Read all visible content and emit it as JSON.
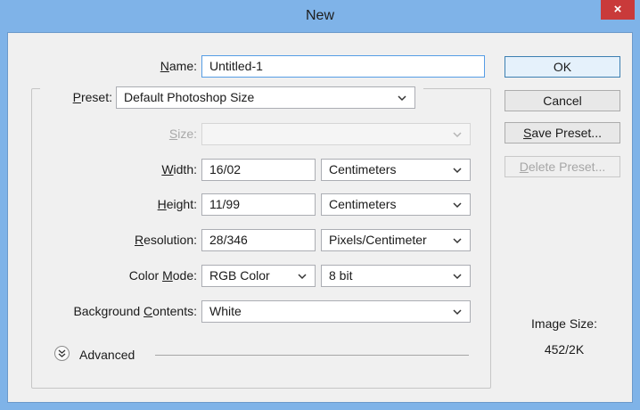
{
  "window": {
    "title": "New",
    "close_glyph": "×"
  },
  "name": {
    "label_pre": "",
    "label_key": "N",
    "label_post": "ame:",
    "value": "Untitled-1"
  },
  "preset": {
    "label_pre": "",
    "label_key": "P",
    "label_post": "reset:",
    "value": "Default Photoshop Size"
  },
  "size": {
    "label_pre": "",
    "label_key": "S",
    "label_post": "ize:",
    "value": ""
  },
  "width": {
    "label_pre": "",
    "label_key": "W",
    "label_post": "idth:",
    "value": "16/02",
    "unit": "Centimeters"
  },
  "height": {
    "label_pre": "",
    "label_key": "H",
    "label_post": "eight:",
    "value": "11/99",
    "unit": "Centimeters"
  },
  "resolution": {
    "label_pre": "",
    "label_key": "R",
    "label_post": "esolution:",
    "value": "28/346",
    "unit": "Pixels/Centimeter"
  },
  "color_mode": {
    "label_pre": "Color ",
    "label_key": "M",
    "label_post": "ode:",
    "value": "RGB Color",
    "bits": "8 bit"
  },
  "background": {
    "label_pre": "Background ",
    "label_key": "C",
    "label_post": "ontents:",
    "value": "White"
  },
  "advanced": {
    "label": "Advanced"
  },
  "buttons": {
    "ok": "OK",
    "cancel": "Cancel",
    "save_preset_key": "S",
    "save_preset_rest": "ave Preset...",
    "delete_preset_key": "D",
    "delete_preset_rest": "elete Preset..."
  },
  "image_size": {
    "label": "Image Size:",
    "value": "452/2K"
  },
  "icons": {
    "close": "close-icon",
    "dropdown": "chevron-down-icon",
    "advanced": "double-chevron-down-icon"
  },
  "colors": {
    "titlebar": "#7fb3e8",
    "close_button": "#c93a3a",
    "dialog_bg": "#f0f0f0",
    "focus_border": "#569de5"
  }
}
